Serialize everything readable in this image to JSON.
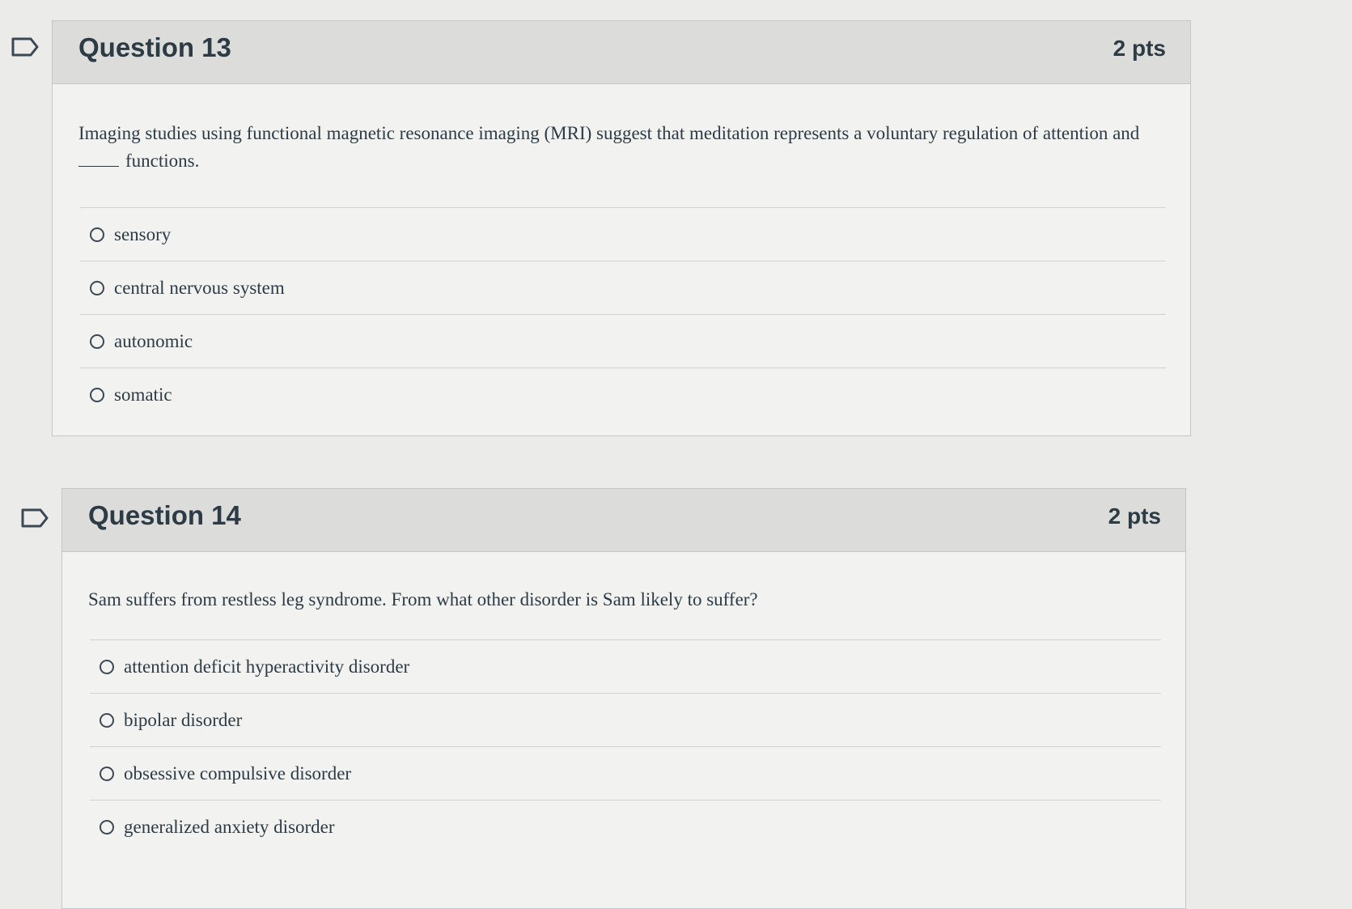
{
  "questions": [
    {
      "title": "Question 13",
      "points": "2 pts",
      "text_main": "Imaging studies using functional magnetic resonance imaging (MRI) suggest that meditation represents a voluntary regulation of attention and",
      "text_tail": "functions.",
      "answers": [
        "sensory",
        "central nervous system",
        "autonomic",
        "somatic"
      ]
    },
    {
      "title": "Question 14",
      "points": "2 pts",
      "text_main": "Sam suffers from restless leg syndrome. From what other disorder is Sam likely to suffer?",
      "answers": [
        "attention deficit hyperactivity disorder",
        "bipolar disorder",
        "obsessive compulsive disorder",
        "generalized anxiety disorder"
      ]
    }
  ],
  "icons": {
    "flag": "flag-question-icon",
    "radio": "radio-button-icon"
  },
  "colors": {
    "page_background": "#ebebe9",
    "header_background": "#dcdcdb",
    "text": "#2d3b45"
  }
}
